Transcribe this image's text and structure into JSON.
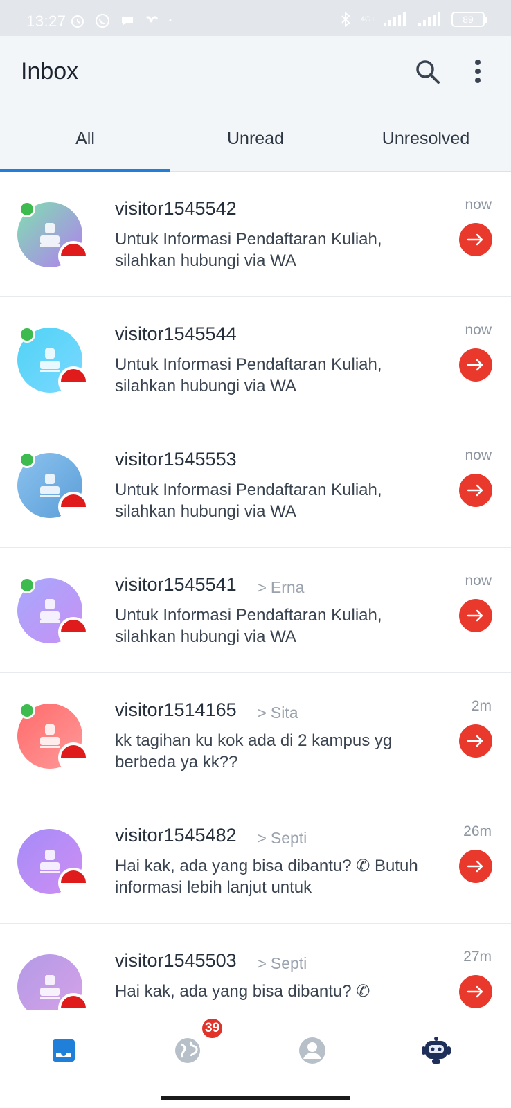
{
  "status_bar": {
    "time": "13:27",
    "network_label": "4G+",
    "battery": "89"
  },
  "header": {
    "title": "Inbox",
    "icons": [
      "search-icon",
      "more-vertical-icon"
    ]
  },
  "tabs": [
    {
      "label": "All",
      "active": true
    },
    {
      "label": "Unread",
      "active": false
    },
    {
      "label": "Unresolved",
      "active": false
    }
  ],
  "conversations": [
    {
      "name": "visitor1545542",
      "agent": "",
      "message": "Untuk Informasi Pendaftaran Kuliah, silahkan hubungi via WA",
      "time": "now",
      "online": true,
      "avatar_colors": [
        "#7fe0b0",
        "#b27df0"
      ]
    },
    {
      "name": "visitor1545544",
      "agent": "",
      "message": "Untuk Informasi Pendaftaran Kuliah, silahkan hubungi via WA",
      "time": "now",
      "online": true,
      "avatar_colors": [
        "#4fd3f5",
        "#7cd8ff"
      ]
    },
    {
      "name": "visitor1545553",
      "agent": "",
      "message": "Untuk Informasi Pendaftaran Kuliah, silahkan hubungi via WA",
      "time": "now",
      "online": true,
      "avatar_colors": [
        "#8cc2ee",
        "#5a9ed8"
      ]
    },
    {
      "name": "visitor1545541",
      "agent": "Erna",
      "message": "Untuk Informasi Pendaftaran Kuliah, silahkan hubungi via WA",
      "time": "now",
      "online": true,
      "avatar_colors": [
        "#a7a7fb",
        "#c791f5"
      ]
    },
    {
      "name": "visitor1514165",
      "agent": "Sita",
      "message": "kk tagihan ku kok ada di 2 kampus yg berbeda ya kk??",
      "time": "2m",
      "online": true,
      "avatar_colors": [
        "#ff6b6b",
        "#ff9a9a"
      ]
    },
    {
      "name": "visitor1545482",
      "agent": "Septi",
      "message": "Hai kak, ada yang bisa dibantu? ✆ Butuh informasi lebih lanjut untuk",
      "time": "26m",
      "online": false,
      "avatar_colors": [
        "#a58cf8",
        "#cf8ef3"
      ]
    },
    {
      "name": "visitor1545503",
      "agent": "Septi",
      "message": "Hai kak, ada yang bisa dibantu? ✆",
      "time": "27m",
      "online": false,
      "avatar_colors": [
        "#b39ae6",
        "#d7a2e8"
      ]
    }
  ],
  "bottom_nav": {
    "items": [
      "inbox-icon",
      "globe-icon",
      "profile-icon",
      "bot-icon"
    ],
    "badge_count": "39"
  },
  "colors": {
    "accent": "#1f7fd9",
    "go_button": "#e8392c",
    "online": "#3dbb4e"
  }
}
